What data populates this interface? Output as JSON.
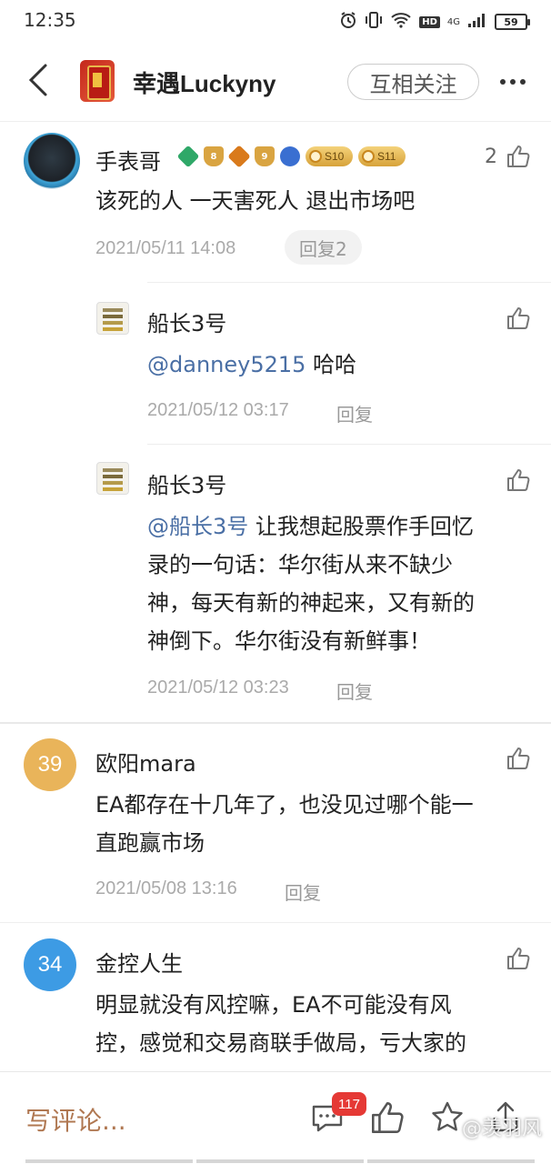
{
  "status_bar": {
    "time": "12:35",
    "network": "4G",
    "hd": "HD",
    "battery": "59"
  },
  "header": {
    "title": "幸遇Luckyny",
    "follow_label": "互相关注"
  },
  "comments": [
    {
      "username": "手表哥",
      "badges": [
        "S10",
        "S11"
      ],
      "like_count": "2",
      "text": "该死的人 一天害死人 退出市场吧",
      "time": "2021/05/11 14:08",
      "reply_label": "回复2",
      "replies": [
        {
          "username": "船长3号",
          "mention": "@danney5215",
          "text": " 哈哈",
          "time": "2021/05/12 03:17",
          "reply_label": "回复"
        },
        {
          "username": "船长3号",
          "mention": "@船长3号",
          "text_line1": " 让我想起股票作手回忆",
          "text_line2": "录的一句话：华尔街从来不缺少",
          "text_line3": "神，每天有新的神起来，又有新的",
          "text_line4": "神倒下。华尔街没有新鲜事！",
          "time": "2021/05/12 03:23",
          "reply_label": "回复"
        }
      ]
    },
    {
      "username": "欧阳mara",
      "avatar_text": "39",
      "avatar_color": "#e9b45a",
      "text_line1": "EA都存在十几年了，也没见过哪个能一",
      "text_line2": "直跑赢市场",
      "time": "2021/05/08 13:16",
      "reply_label": "回复"
    },
    {
      "username": "金控人生",
      "avatar_text": "34",
      "avatar_color": "#3d9be4",
      "text_line1": "明显就没有风控嘛，EA不可能没有风",
      "text_line2": "控，感觉和交易商联手做局，亏大家的"
    }
  ],
  "bottom_bar": {
    "write_comment": "写评论...",
    "notification_count": "117",
    "watermark": "@羡羽风"
  }
}
